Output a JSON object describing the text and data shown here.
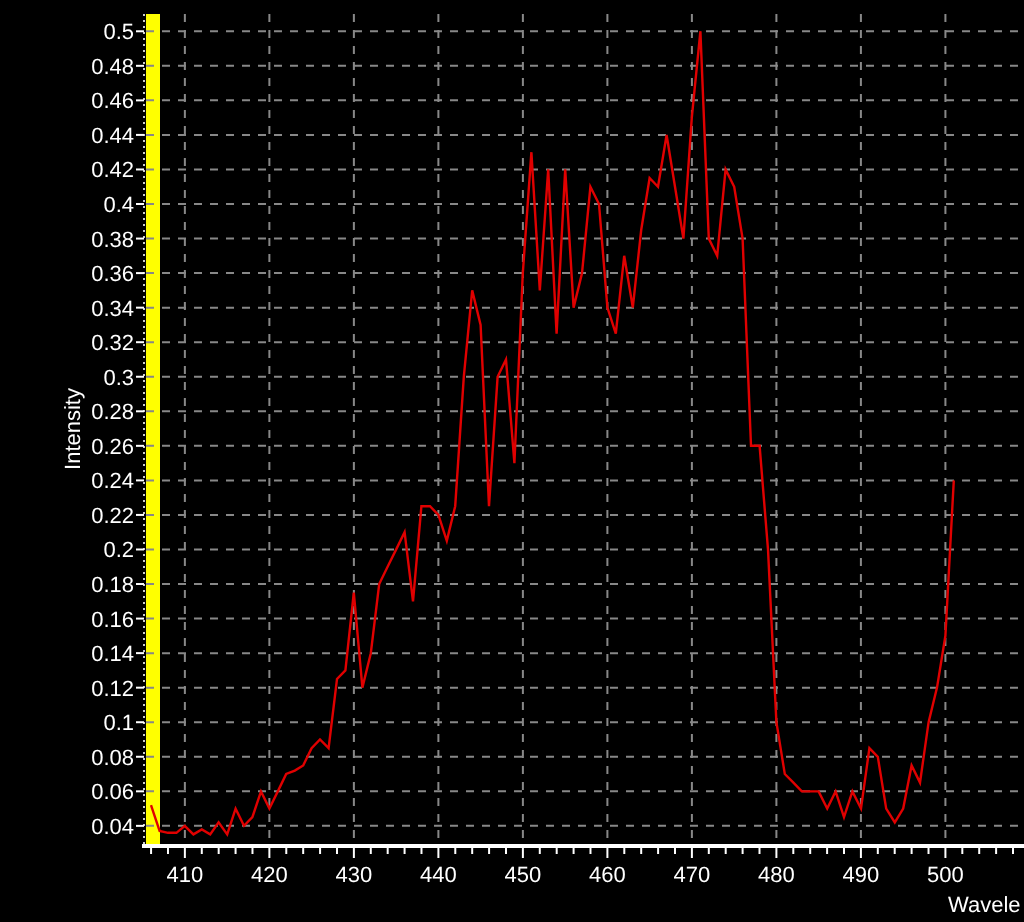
{
  "plot": {
    "chart_data": {
      "type": "line",
      "xlabel": "Wavele",
      "ylabel": "Intensity",
      "xlim": [
        405.4,
        509.3
      ],
      "ylim": [
        0.0295,
        0.51
      ],
      "xticks": [
        410,
        420,
        430,
        440,
        450,
        460,
        470,
        480,
        490,
        500
      ],
      "yticks": [
        0.04,
        0.06,
        0.08,
        0.1,
        0.12,
        0.14,
        0.16,
        0.18,
        0.2,
        0.22,
        0.24,
        0.26,
        0.28,
        0.3,
        0.32,
        0.34,
        0.36,
        0.38,
        0.4,
        0.42,
        0.44,
        0.46,
        0.48,
        0.5
      ],
      "x": [
        406,
        407,
        408,
        409,
        410,
        411,
        412,
        413,
        414,
        415,
        416,
        417,
        418,
        419,
        420,
        421,
        422,
        423,
        424,
        425,
        426,
        427,
        428,
        429,
        430,
        431,
        432,
        433,
        434,
        435,
        436,
        437,
        438,
        439,
        440,
        441,
        442,
        443,
        444,
        445,
        446,
        447,
        448,
        449,
        450,
        451,
        452,
        453,
        454,
        455,
        456,
        457,
        458,
        459,
        460,
        461,
        462,
        463,
        464,
        465,
        466,
        467,
        468,
        469,
        470,
        471,
        472,
        473,
        474,
        475,
        476,
        477,
        478,
        479,
        480,
        481,
        482,
        483,
        484,
        485,
        486,
        487,
        488,
        489,
        490,
        491,
        492,
        493,
        494,
        495,
        496,
        497,
        498,
        499,
        500,
        501
      ],
      "series": [
        {
          "color": "#e00000",
          "values": [
            0.052,
            0.037,
            0.036,
            0.036,
            0.04,
            0.035,
            0.038,
            0.035,
            0.042,
            0.035,
            0.05,
            0.04,
            0.045,
            0.06,
            0.05,
            0.06,
            0.07,
            0.072,
            0.075,
            0.085,
            0.09,
            0.085,
            0.125,
            0.13,
            0.175,
            0.12,
            0.14,
            0.18,
            0.19,
            0.2,
            0.21,
            0.17,
            0.225,
            0.225,
            0.22,
            0.205,
            0.225,
            0.3,
            0.35,
            0.33,
            0.225,
            0.3,
            0.31,
            0.25,
            0.36,
            0.43,
            0.35,
            0.42,
            0.325,
            0.42,
            0.34,
            0.36,
            0.41,
            0.4,
            0.34,
            0.325,
            0.37,
            0.34,
            0.385,
            0.415,
            0.41,
            0.44,
            0.41,
            0.38,
            0.45,
            0.5,
            0.38,
            0.37,
            0.42,
            0.41,
            0.38,
            0.26,
            0.26,
            0.2,
            0.1,
            0.07,
            0.065,
            0.06,
            0.06,
            0.06,
            0.05,
            0.06,
            0.045,
            0.06,
            0.05,
            0.085,
            0.08,
            0.05,
            0.042,
            0.05,
            0.075,
            0.065,
            0.1,
            0.12,
            0.15,
            0.24
          ]
        }
      ],
      "grid": true
    }
  }
}
